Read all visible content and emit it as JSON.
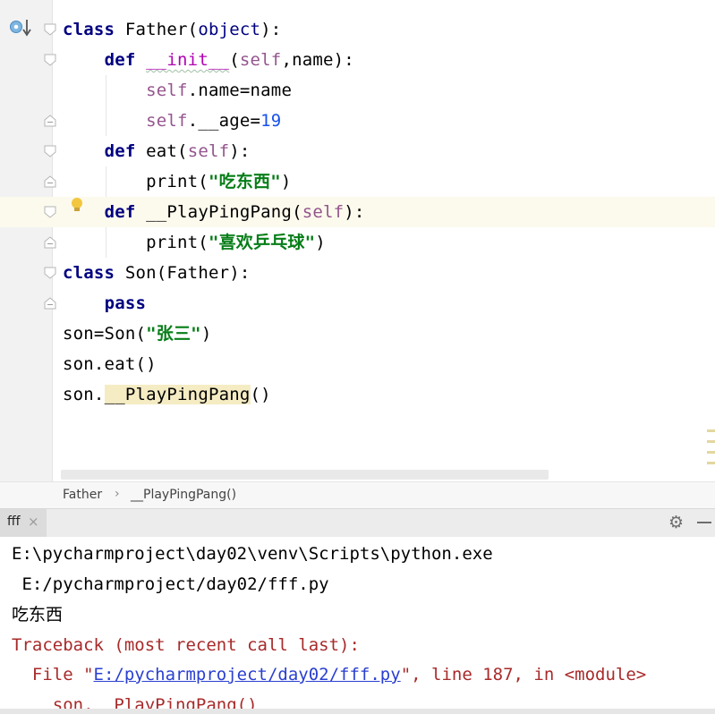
{
  "editor": {
    "lines": [
      {
        "parts": [
          {
            "t": "class",
            "c": "kw"
          },
          {
            "t": " Father("
          },
          {
            "t": "object",
            "c": "kwn"
          },
          {
            "t": "):"
          }
        ]
      },
      {
        "parts": [
          {
            "t": "    "
          },
          {
            "t": "def",
            "c": "kw"
          },
          {
            "t": " "
          },
          {
            "t": "__init__",
            "c": "mag sq"
          },
          {
            "t": "("
          },
          {
            "t": "self",
            "c": "slf"
          },
          {
            "t": ",name):"
          }
        ]
      },
      {
        "parts": [
          {
            "t": "        "
          },
          {
            "t": "self",
            "c": "slf"
          },
          {
            "t": ".name=name"
          }
        ]
      },
      {
        "parts": [
          {
            "t": "        "
          },
          {
            "t": "self",
            "c": "slf"
          },
          {
            "t": ".__age="
          },
          {
            "t": "19",
            "c": "num"
          }
        ]
      },
      {
        "parts": [
          {
            "t": "    "
          },
          {
            "t": "def",
            "c": "kw"
          },
          {
            "t": " eat("
          },
          {
            "t": "self",
            "c": "slf"
          },
          {
            "t": "):"
          }
        ]
      },
      {
        "parts": [
          {
            "t": "        print("
          },
          {
            "t": "\"吃东西\"",
            "c": "str"
          },
          {
            "t": ")"
          }
        ]
      },
      {
        "parts": [
          {
            "t": "    "
          },
          {
            "t": "def",
            "c": "kw"
          },
          {
            "t": " __PlayPingPang("
          },
          {
            "t": "self",
            "c": "slf"
          },
          {
            "t": "):"
          }
        ]
      },
      {
        "parts": [
          {
            "t": "        print("
          },
          {
            "t": "\"喜欢乒乓球\"",
            "c": "str"
          },
          {
            "t": ")"
          }
        ]
      },
      {
        "parts": [
          {
            "t": "class",
            "c": "kw"
          },
          {
            "t": " Son(Father):"
          }
        ]
      },
      {
        "parts": [
          {
            "t": "    "
          },
          {
            "t": "pass",
            "c": "kw"
          }
        ]
      },
      {
        "parts": [
          {
            "t": "son=Son("
          },
          {
            "t": "\"张三\"",
            "c": "str"
          },
          {
            "t": ")"
          }
        ]
      },
      {
        "parts": [
          {
            "t": "son.eat()"
          }
        ]
      },
      {
        "parts": [
          {
            "t": "son."
          },
          {
            "t": "__PlayPingPang",
            "c": "hlname"
          },
          {
            "t": "()"
          }
        ]
      }
    ]
  },
  "breadcrumb": {
    "item1": "Father",
    "separator": "›",
    "item2": "__PlayPingPang()"
  },
  "run_panel": {
    "tab_label": "fff",
    "close_glyph": "×",
    "settings_glyph": "⚙"
  },
  "console": {
    "line1": "E:\\pycharmproject\\day02\\venv\\Scripts\\python.exe",
    "line2": " E:/pycharmproject/day02/fff.py",
    "line3": "吃东西",
    "line4": "Traceback (most recent call last):",
    "line5_a": "  File \"",
    "line5_link": "E:/pycharmproject/day02/fff.py",
    "line5_b": "\", line 187, in <module>",
    "line6": "    son.__PlayPingPang()"
  },
  "icons": [
    "run-marker-icon",
    "fold-icon",
    "bulb-icon",
    "gear-icon",
    "minimize-icon",
    "close-icon"
  ]
}
